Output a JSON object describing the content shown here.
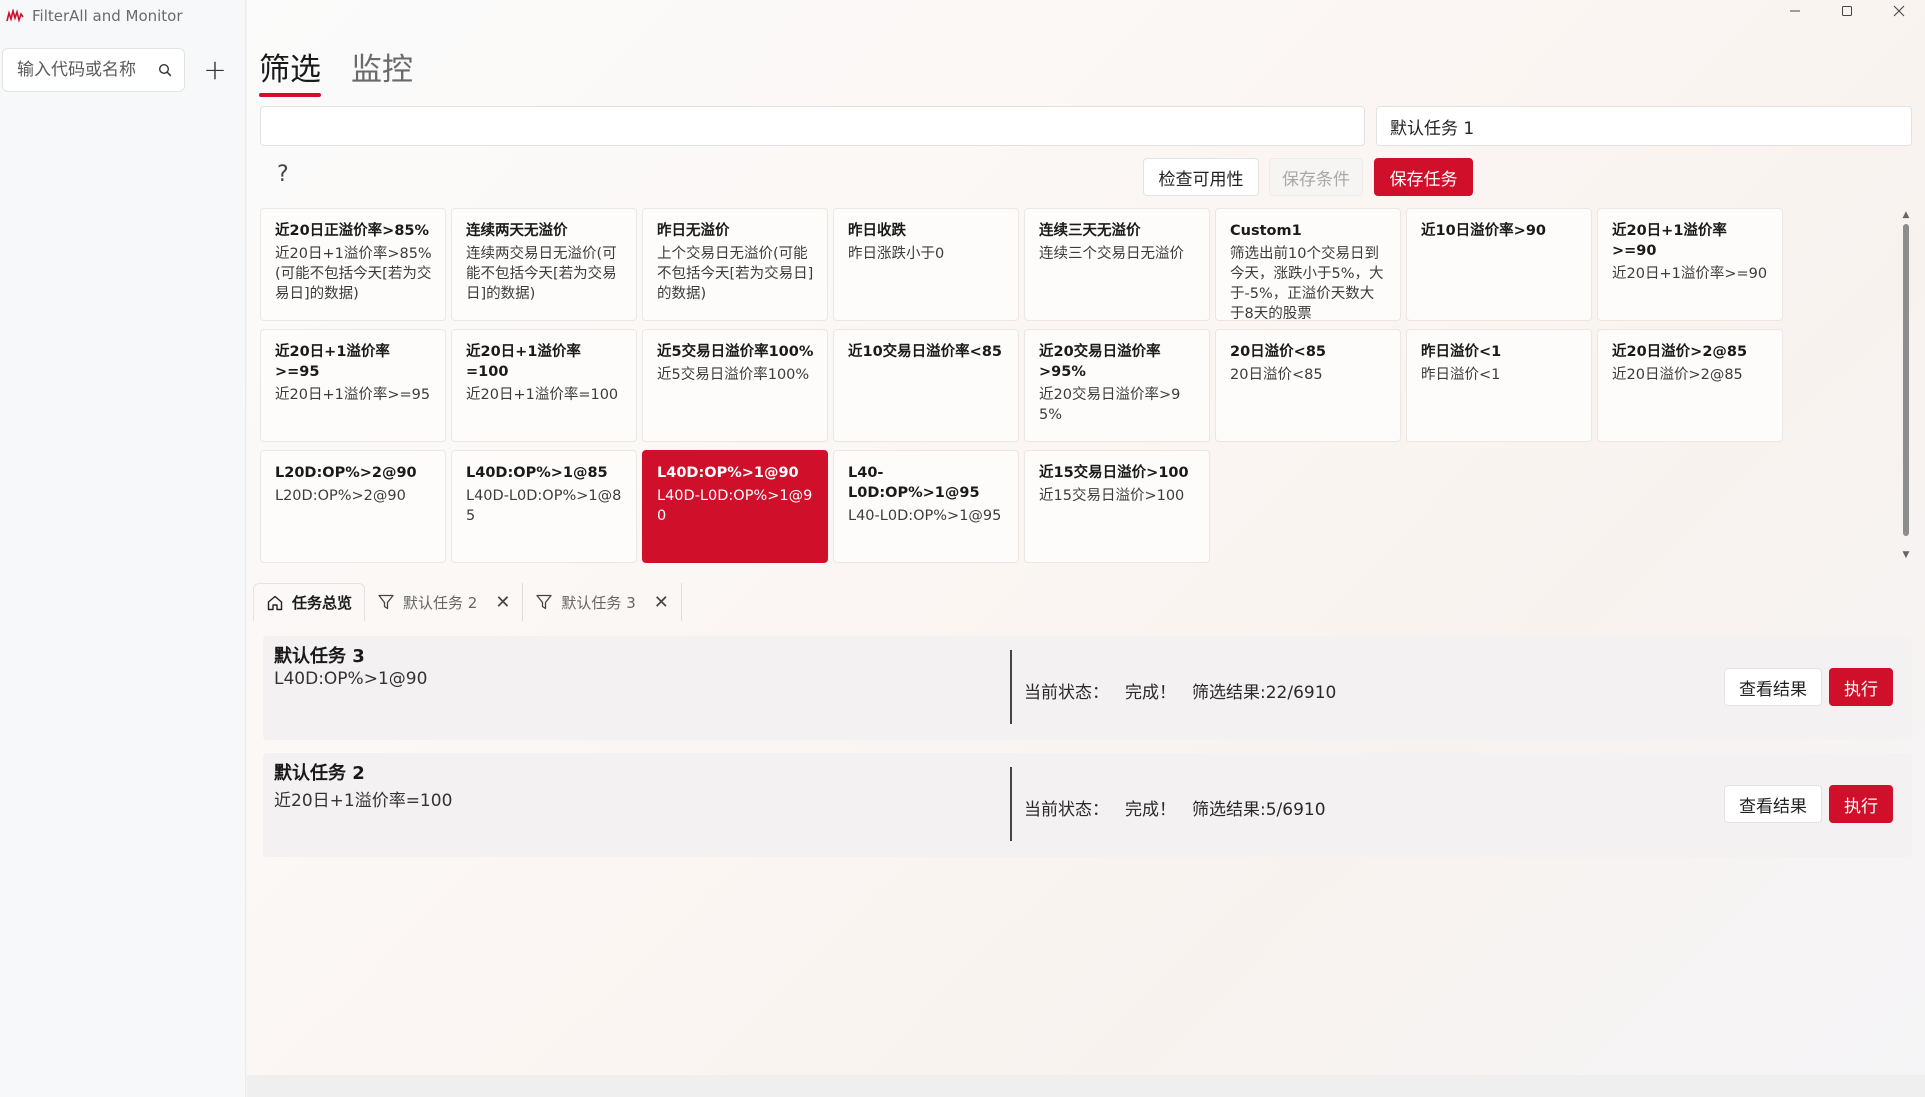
{
  "app": {
    "title": "FilterAll and Monitor"
  },
  "sidebar": {
    "search_placeholder": "输入代码或名称",
    "add_label": "+"
  },
  "top_tabs": [
    {
      "label": "筛选",
      "active": true
    },
    {
      "label": "监控",
      "active": false
    }
  ],
  "editor": {
    "condition_value": "",
    "task_name_value": "默认任务 1",
    "help_label": "?",
    "check_label": "检查可用性",
    "save_condition_label": "保存条件",
    "save_task_label": "保存任务"
  },
  "conditions": [
    {
      "title": "近20日正溢价率>85%",
      "desc": "近20日+1溢价率>85%(可能不包括今天[若为交易日]的数据)"
    },
    {
      "title": "连续两天无溢价",
      "desc": "连续两交易日无溢价(可能不包括今天[若为交易日]的数据)"
    },
    {
      "title": "昨日无溢价",
      "desc": "上个交易日无溢价(可能不包括今天[若为交易日]的数据)"
    },
    {
      "title": "昨日收跌",
      "desc": "昨日涨跌小于0"
    },
    {
      "title": "连续三天无溢价",
      "desc": "连续三个交易日无溢价"
    },
    {
      "title": "Custom1",
      "desc": "筛选出前10个交易日到今天，涨跌小于5%，大于-5%，正溢价天数大于8天的股票"
    },
    {
      "title": "近10日溢价率>90",
      "desc": ""
    },
    {
      "title": "近20日+1溢价率>=90",
      "desc": "近20日+1溢价率>=90"
    },
    {
      "title": "近20日+1溢价率>=95",
      "desc": "近20日+1溢价率>=95"
    },
    {
      "title": "近20日+1溢价率=100",
      "desc": "近20日+1溢价率=100"
    },
    {
      "title": "近5交易日溢价率100%",
      "desc": "近5交易日溢价率100%"
    },
    {
      "title": "近10交易日溢价率<85",
      "desc": ""
    },
    {
      "title": "近20交易日溢价率>95%",
      "desc": "近20交易日溢价率>95%"
    },
    {
      "title": "20日溢价<85",
      "desc": "20日溢价<85"
    },
    {
      "title": "昨日溢价<1",
      "desc": "昨日溢价<1"
    },
    {
      "title": "近20日溢价>2@85",
      "desc": "近20日溢价>2@85"
    },
    {
      "title": "L20D:OP%>2@90",
      "desc": "L20D:OP%>2@90"
    },
    {
      "title": "L40D:OP%>1@85",
      "desc": "L40D-L0D:OP%>1@85"
    },
    {
      "title": "L40D:OP%>1@90",
      "desc": "L40D-L0D:OP%>1@90",
      "selected": true
    },
    {
      "title": "L40-L0D:OP%>1@95",
      "desc": "L40-L0D:OP%>1@95"
    },
    {
      "title": "近15交易日溢价>100",
      "desc": "近15交易日溢价>100"
    }
  ],
  "task_tabs": [
    {
      "label": "任务总览",
      "icon": "home-icon",
      "active": true,
      "closable": false
    },
    {
      "label": "默认任务 2",
      "icon": "filter-icon",
      "active": false,
      "closable": true
    },
    {
      "label": "默认任务 3",
      "icon": "filter-icon",
      "active": false,
      "closable": true
    }
  ],
  "tasks": [
    {
      "name": "默认任务 3",
      "condition": "L40D:OP%>1@90",
      "status_label": "当前状态：",
      "status": "完成！",
      "result": "筛选结果:22/6910",
      "view_label": "查看结果",
      "run_label": "执行"
    },
    {
      "name": "默认任务 2",
      "condition": "近20日+1溢价率=100",
      "status_label": "当前状态：",
      "status": "完成！",
      "result": "筛选结果:5/6910",
      "view_label": "查看结果",
      "run_label": "执行"
    }
  ],
  "colors": {
    "accent": "#d0102a"
  }
}
